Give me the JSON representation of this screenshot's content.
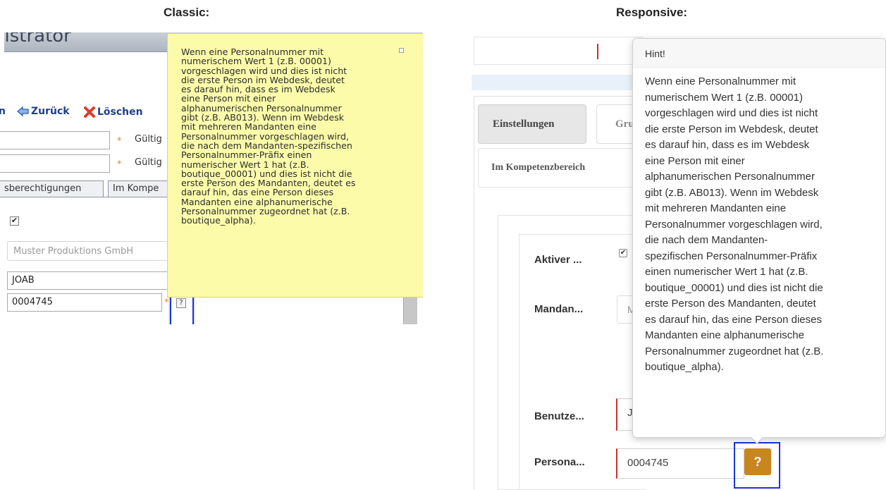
{
  "headings": {
    "classic": "Classic:",
    "responsive": "Responsive:"
  },
  "classic": {
    "title_fragment": "nistrator",
    "toolbar": {
      "fragment": "n",
      "back_label": "Zurück",
      "delete_label": "Löschen"
    },
    "valid_label": "Gültig",
    "required_mark": "*",
    "tabs": [
      "sberechtigungen",
      "Im Kompe"
    ],
    "checkbox_checked": true,
    "client_placeholder": "Muster Produktions GmbH",
    "user_value": "JOAB",
    "personnel_value": "0004745",
    "help_glyph": "?",
    "tooltip_lines": [
      "Wenn eine Personalnummer mit",
      "numerischem Wert 1 (z.B. 00001)",
      "vorgeschlagen wird und dies ist nicht",
      "die erste Person im Webdesk, deutet",
      "es darauf hin, dass es im Webdesk",
      "eine Person mit einer",
      "alphanumerischen Personalnummer",
      "gibt (z.B. AB013). Wenn im Webdesk",
      "mit mehreren Mandanten eine",
      "Personalnummer vorgeschlagen wird,",
      "die nach dem Mandanten-spezifischen",
      "Personalnummer-Präfix einen",
      "numerischer Wert 1 hat (z.B.",
      "boutique_00001) und dies ist nicht die",
      "erste Person des Mandanten, deutet es",
      "darauf hin, das eine Person dieses",
      "Mandanten eine alphanumerische",
      "Personalnummer zugeordnet hat (z.B.",
      "boutique_alpha)."
    ]
  },
  "responsive": {
    "tabs": {
      "settings": "Einstellungen",
      "groups": "Gru",
      "competence": "Im Kompetenzbereich"
    },
    "labels": {
      "active": "Aktiver ...",
      "client": "Mandan...",
      "user": "Benutze...",
      "personnel": "Persona..."
    },
    "client_placeholder_fragment": "M",
    "user_value_fragment": "J",
    "personnel_value": "0004745",
    "help_glyph": "?",
    "popover_title": "Hint!",
    "popover_lines": [
      "Wenn eine Personalnummer mit",
      "numerischem Wert 1 (z.B. 00001)",
      "vorgeschlagen wird und dies ist nicht",
      "die erste Person im Webdesk, deutet",
      "es darauf hin, dass es im Webdesk",
      "eine Person mit einer",
      "alphanumerischen Personalnummer",
      "gibt (z.B. AB013). Wenn im Webdesk",
      "mit mehreren Mandanten eine",
      "Personalnummer vorgeschlagen wird,",
      "die nach dem Mandanten-",
      "spezifischen Personalnummer-Präfix",
      "einen numerischer Wert 1 hat (z.B.",
      "boutique_00001) und dies ist nicht die",
      "erste Person des Mandanten, deutet",
      "es darauf hin, das eine Person dieses",
      "Mandanten eine alphanumerische",
      "Personalnummer zugeordnet hat (z.B.",
      "boutique_alpha)."
    ]
  },
  "colors": {
    "tooltip_bg": "#fbfbaa",
    "highlight": "#1a35d6",
    "help_button": "#c8861f",
    "required": "#c73030",
    "toolbar_link": "#1f3f8a"
  }
}
